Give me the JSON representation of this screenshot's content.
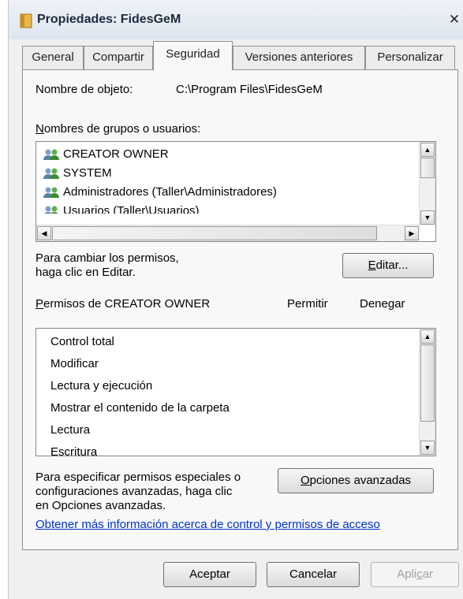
{
  "window": {
    "title": "Propiedades: FidesGeM",
    "close_glyph": "✕"
  },
  "tabs": [
    {
      "label": "General"
    },
    {
      "label": "Compartir"
    },
    {
      "label": "Seguridad"
    },
    {
      "label": "Versiones anteriores"
    },
    {
      "label": "Personalizar"
    }
  ],
  "security": {
    "object_name_label": "Nombre de objeto:",
    "object_name_value": "C:\\Program Files\\FidesGeM",
    "groups_label_first": "N",
    "groups_label_rest": "ombres de grupos o usuarios:",
    "users": [
      {
        "name": "CREATOR OWNER",
        "icon": "users-icon"
      },
      {
        "name": "SYSTEM",
        "icon": "users-icon"
      },
      {
        "name": "Administradores (Taller\\Administradores)",
        "icon": "users-icon"
      },
      {
        "name": "Usuarios (Taller\\Usuarios)",
        "icon": "users-icon"
      }
    ],
    "change_hint_line1": "Para cambiar los permisos,",
    "change_hint_line2": "haga clic en Editar.",
    "edit_button_first": "E",
    "edit_button_rest": "ditar...",
    "permissions_label_first": "P",
    "permissions_label_rest": "ermisos de CREATOR OWNER",
    "allow_header": "Permitir",
    "deny_header": "Denegar",
    "permissions": [
      {
        "name": "Control total"
      },
      {
        "name": "Modificar"
      },
      {
        "name": "Lectura y ejecución"
      },
      {
        "name": "Mostrar el contenido de la carpeta"
      },
      {
        "name": "Lectura"
      },
      {
        "name": "Escritura"
      }
    ],
    "special_hint_line1": "Para especificar permisos especiales o",
    "special_hint_line2": "configuraciones avanzadas, haga clic",
    "special_hint_line3": "en Opciones avanzadas.",
    "advanced_button_first": "O",
    "advanced_button_rest": "pciones avanzadas",
    "info_link": "Obtener más información acerca de control y permisos de acceso"
  },
  "footer": {
    "ok_label": "Aceptar",
    "cancel_label": "Cancelar",
    "apply_label_pre": "Apli",
    "apply_label_u": "c",
    "apply_label_post": "ar"
  },
  "colors": {
    "accent": "#3c7fb1",
    "link": "#0033cc"
  }
}
